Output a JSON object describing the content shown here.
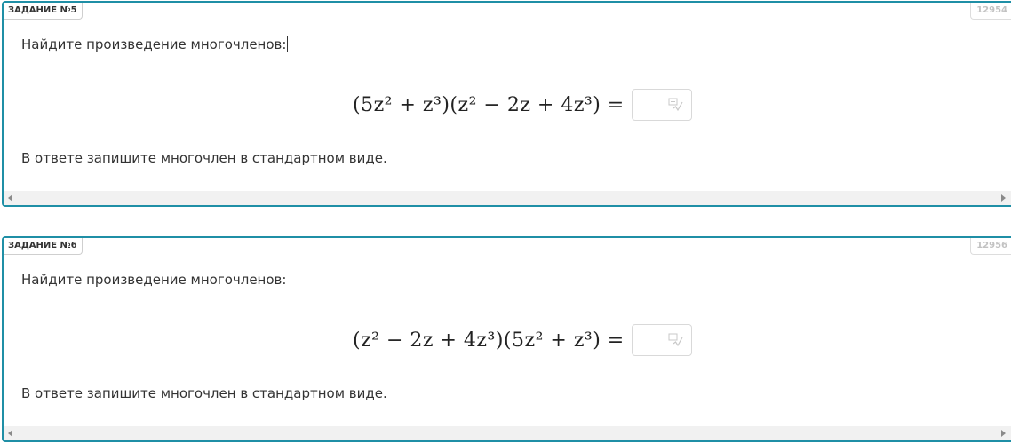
{
  "tasks": [
    {
      "label": "ЗАДАНИЕ №5",
      "id": "12954",
      "prompt": "Найдите произведение многочленов:",
      "formula": "(5z² + z³)(z² − 2z + 4z³) =",
      "answer_value": "",
      "answer_icon": "formula-editor-icon",
      "instruction": "В ответе запишите многочлен в стандартном виде."
    },
    {
      "label": "ЗАДАНИЕ №6",
      "id": "12956",
      "prompt": "Найдите произведение многочленов:",
      "formula": "(z² − 2z + 4z³)(5z² + z³) =",
      "answer_value": "",
      "answer_icon": "formula-editor-icon",
      "instruction": "В ответе запишите многочлен в стандартном виде."
    }
  ],
  "colors": {
    "card_border": "#1f8fa6",
    "id_text": "#c2c2c2",
    "text": "#333333",
    "scrollbar": "#f1f1f1"
  }
}
